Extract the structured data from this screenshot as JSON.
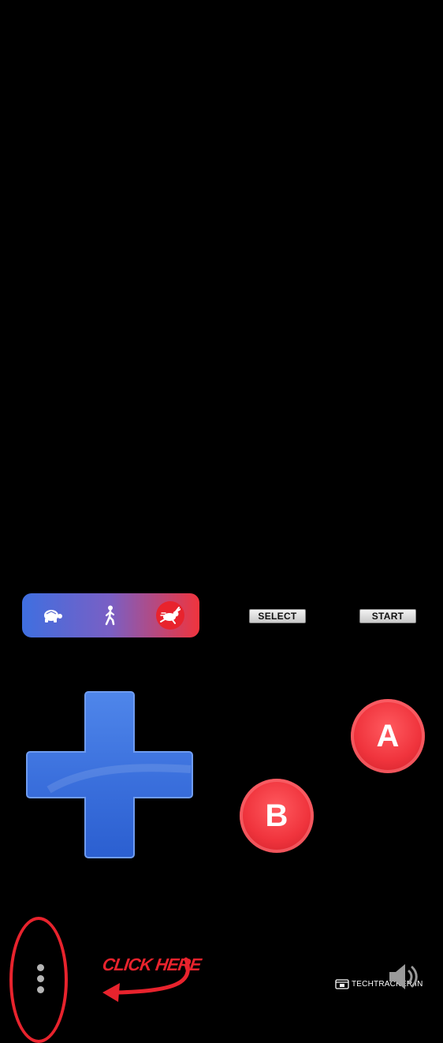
{
  "speed_bar": {
    "slow_icon": "turtle-icon",
    "normal_icon": "walking-person-icon",
    "fast_icon": "running-rabbit-icon",
    "gradient_start": "#3f6fe0",
    "gradient_end": "#f0343d",
    "selected": "fast"
  },
  "controls": {
    "select_label": "SELECT",
    "start_label": "START",
    "a_label": "A",
    "b_label": "B",
    "button_color": "#f0343d",
    "dpad_color": "#3a72df"
  },
  "bottom": {
    "menu_icon": "vertical-dots-icon",
    "callout_text": "CLICK HERE",
    "callout_color": "#e8232d",
    "watermark_text": "TECHTRACKER.IN",
    "volume_icon": "speaker-icon"
  }
}
